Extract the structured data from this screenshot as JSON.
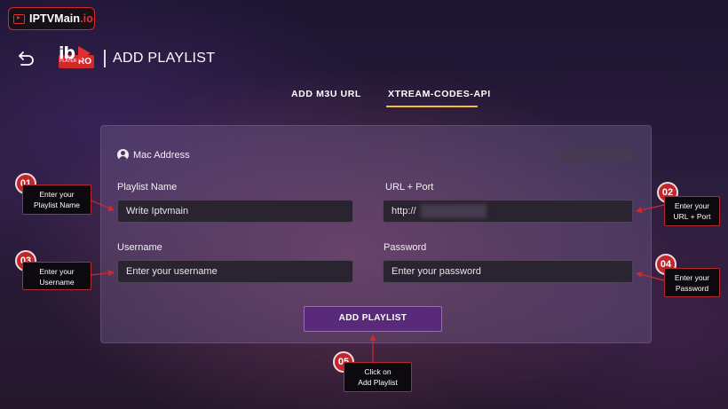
{
  "brand": {
    "name_main": "IPTVMain",
    "name_suffix": ".io",
    "accent": "#e03030"
  },
  "header": {
    "title": "ADD PLAYLIST",
    "logo_text": "ib",
    "logo_pro": "RO",
    "logo_small": "PLAYER"
  },
  "tabs": [
    {
      "label": "ADD M3U URL",
      "active": false
    },
    {
      "label": "XTREAM-CODES-API",
      "active": true
    }
  ],
  "form": {
    "mac_label": "Mac Address",
    "playlist_name": {
      "label": "Playlist Name",
      "value": "Write Iptvmain"
    },
    "url_port": {
      "label": "URL + Port",
      "value": "http://"
    },
    "username": {
      "label": "Username",
      "placeholder": "Enter your username"
    },
    "password": {
      "label": "Password",
      "placeholder": "Enter your password"
    },
    "submit_label": "ADD PLAYLIST"
  },
  "callouts": [
    {
      "num": "01",
      "line1": "Enter your",
      "line2": "Playlist Name"
    },
    {
      "num": "02",
      "line1": "Enter your",
      "line2": "URL + Port"
    },
    {
      "num": "03",
      "line1": "Enter your",
      "line2": "Username"
    },
    {
      "num": "04",
      "line1": "Enter your",
      "line2": "Password"
    },
    {
      "num": "05",
      "line1": "Click on",
      "line2": "Add Playlist"
    }
  ],
  "colors": {
    "tab_underline": "#f0c030",
    "button": "#5a2a7a",
    "callout_red": "#c0262c"
  }
}
